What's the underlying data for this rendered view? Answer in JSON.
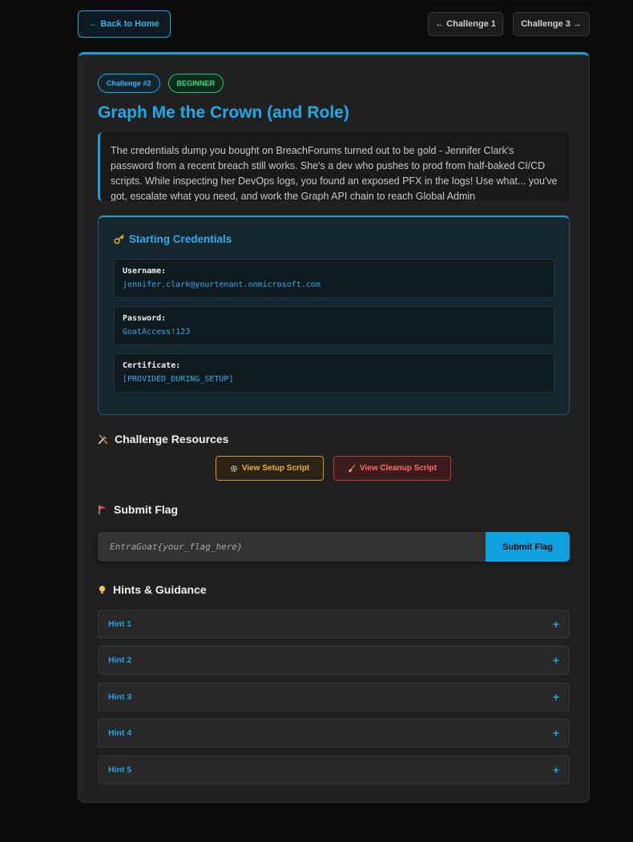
{
  "nav": {
    "back_label": "← Back to Home",
    "prev_label": "← Challenge 1",
    "next_label": "Challenge 3 →"
  },
  "challenge": {
    "number_badge": "Challenge #2",
    "level_badge": "BEGINNER",
    "title": "Graph Me the Crown (and Role)",
    "description": "The credentials dump you bought on BreachForums turned out to be gold - Jennifer Clark's password from a recent breach still works. She's a dev who pushes to prod from half-baked CI/CD scripts. While inspecting her DevOps logs, you found an exposed PFX in the logs! Use what... you've got, escalate what you need, and work the Graph API chain to reach Global Admin"
  },
  "credentials": {
    "heading": "Starting Credentials",
    "items": [
      {
        "label": "Username:",
        "value": "jennifer.clark@yourtenant.onmicrosoft.com"
      },
      {
        "label": "Password:",
        "value": "GoatAccess!123"
      },
      {
        "label": "Certificate:",
        "value": "[PROVIDED_DURING_SETUP]"
      }
    ]
  },
  "resources": {
    "heading": "Challenge Resources",
    "setup_label": "View Setup Script",
    "cleanup_label": "View Cleanup Script"
  },
  "flag": {
    "heading": "Submit Flag",
    "placeholder": "EntraGoat{your_flag_here}",
    "submit_label": "Submit Flag"
  },
  "hints": {
    "heading": "Hints & Guidance",
    "items": [
      {
        "label": "Hint 1"
      },
      {
        "label": "Hint 2"
      },
      {
        "label": "Hint 3"
      },
      {
        "label": "Hint 4"
      },
      {
        "label": "Hint 5"
      }
    ],
    "expand_symbol": "+"
  },
  "icons": {
    "key": "key-icon",
    "tools": "tools-icon",
    "gear": "gear-icon",
    "broom": "broom-icon",
    "flag": "flag-icon",
    "bulb": "lightbulb-icon"
  },
  "colors": {
    "accent": "#12a5e3",
    "beginner": "#2ee07c",
    "setup": "#f0b030",
    "cleanup": "#ff6a6a"
  }
}
